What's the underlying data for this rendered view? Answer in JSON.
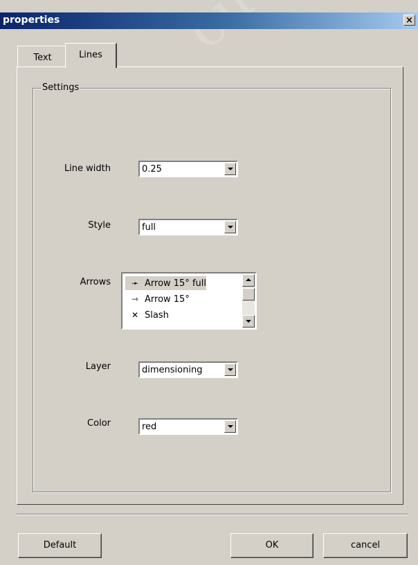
{
  "window": {
    "title": "properties",
    "close_label": "×"
  },
  "tabs": [
    {
      "label": "Text",
      "selected": false
    },
    {
      "label": "Lines",
      "selected": true
    }
  ],
  "group": {
    "label": "Settings"
  },
  "fields": {
    "line_width": {
      "label": "Line width",
      "value": "0.25"
    },
    "style": {
      "label": "Style",
      "value": "full"
    },
    "arrows": {
      "label": "Arrows",
      "items": [
        {
          "glyph": "➛",
          "label": "Arrow 15° full",
          "selected": true
        },
        {
          "glyph": "⇾",
          "label": "Arrow 15°",
          "selected": false
        },
        {
          "glyph": "✕",
          "label": "Slash",
          "selected": false
        }
      ]
    },
    "layer": {
      "label": "Layer",
      "value": "dimensioning"
    },
    "color": {
      "label": "Color",
      "value": "red"
    }
  },
  "buttons": {
    "default": "Default",
    "ok": "OK",
    "cancel": "cancel"
  },
  "watermark": "cuuduong",
  "colors": {
    "face": "#d4d0c8",
    "title_start": "#0a246a",
    "title_end": "#a6caf0"
  }
}
